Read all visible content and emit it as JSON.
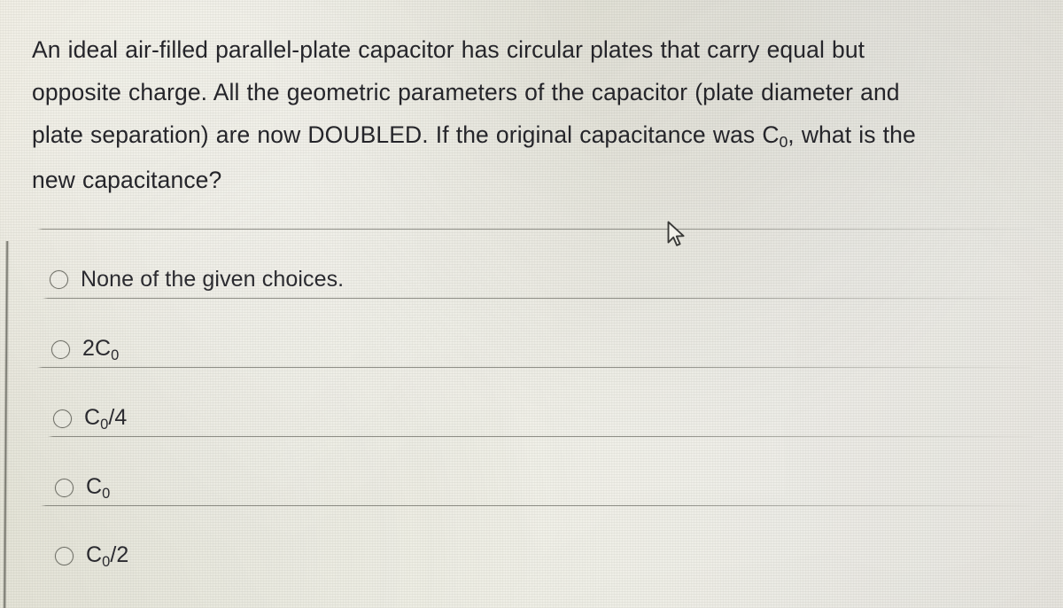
{
  "question": {
    "lines": [
      "An ideal air-filled parallel-plate capacitor has circular plates that carry equal but",
      "opposite charge. All the geometric parameters of the capacitor (plate diameter and",
      "plate separation) are now DOUBLED. If the original capacitance was C₀, what is the",
      "new capacitance?"
    ],
    "line1": "An ideal air-filled parallel-plate capacitor has circular plates that carry equal but",
    "line2": "opposite charge. All the geometric parameters of the capacitor (plate diameter and",
    "line3_a": "plate separation) are now DOUBLED. If the original capacitance was C",
    "line3_sub": "0",
    "line3_b": ", what is the",
    "line4": "new capacitance?"
  },
  "choices": [
    {
      "id": "choice-none",
      "label": "None of the given choices.",
      "base": "None of the given choices.",
      "sub": "",
      "suffix": "",
      "selected": false
    },
    {
      "id": "choice-2c0",
      "label": "2C₀",
      "base": "2C",
      "sub": "0",
      "suffix": "",
      "selected": false
    },
    {
      "id": "choice-c0-div4",
      "label": "C₀/4",
      "base": "C",
      "sub": "0",
      "suffix": "/4",
      "selected": false
    },
    {
      "id": "choice-c0",
      "label": "C₀",
      "base": "C",
      "sub": "0",
      "suffix": "",
      "selected": false
    },
    {
      "id": "choice-c0-div2",
      "label": "C₀/2",
      "base": "C",
      "sub": "0",
      "suffix": "/2",
      "selected": false
    }
  ],
  "cursor": {
    "icon": "mouse-pointer-arrow"
  },
  "colors": {
    "page_background": "#eae9e0",
    "text": "#25252a",
    "divider": "#6a6a62",
    "radio_outline": "#6e6e66"
  }
}
